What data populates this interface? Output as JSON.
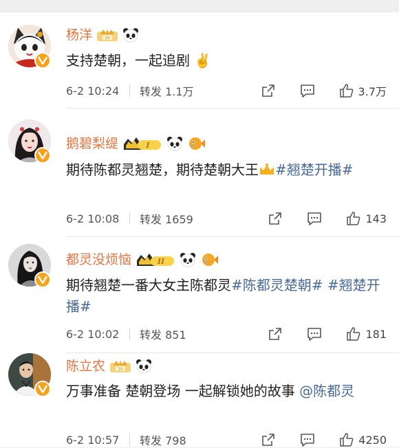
{
  "comments": [
    {
      "name": "杨洋",
      "text_parts": [
        "支持楚朝，一起追剧 ✌️"
      ],
      "time": "6-2 10:24",
      "repost": "转发 1.1万",
      "likes": "3.7万",
      "rank_badge": ""
    },
    {
      "name": "鹅碧梨缇",
      "text_parts": [
        "期待陈都灵翘楚，期待楚朝大王",
        "#翘楚开播#"
      ],
      "time": "6-2 10:08",
      "repost": "转发 1659",
      "likes": "143",
      "rank_badge": "I"
    },
    {
      "name": "都灵没烦恼",
      "text_parts": [
        "期待翘楚一番大女主陈都灵",
        "#陈都灵楚朝# #翘楚开播#"
      ],
      "time": "6-2 10:02",
      "repost": "转发 851",
      "likes": "181",
      "rank_badge": "II"
    },
    {
      "name": "陈立农",
      "text_parts": [
        "万事准备 楚朝登场 一起解锁她的故事 ",
        "@陈都灵"
      ],
      "time": "6-2 10:57",
      "repost": "转发 798",
      "likes": "4250",
      "rank_badge": ""
    }
  ],
  "icons": {
    "forward": "share-box-icon",
    "comment": "comment-bubble-icon",
    "like": "thumbs-up-icon",
    "verified": "verified-v-icon",
    "panda": "panda-icon",
    "fish": "pufferfish-icon",
    "crown": "crown-icon"
  },
  "colors": {
    "username": "#eb7340",
    "hashtag": "#486a99",
    "verified": "#f7a21a",
    "text": "#222222",
    "meta": "#555555"
  }
}
